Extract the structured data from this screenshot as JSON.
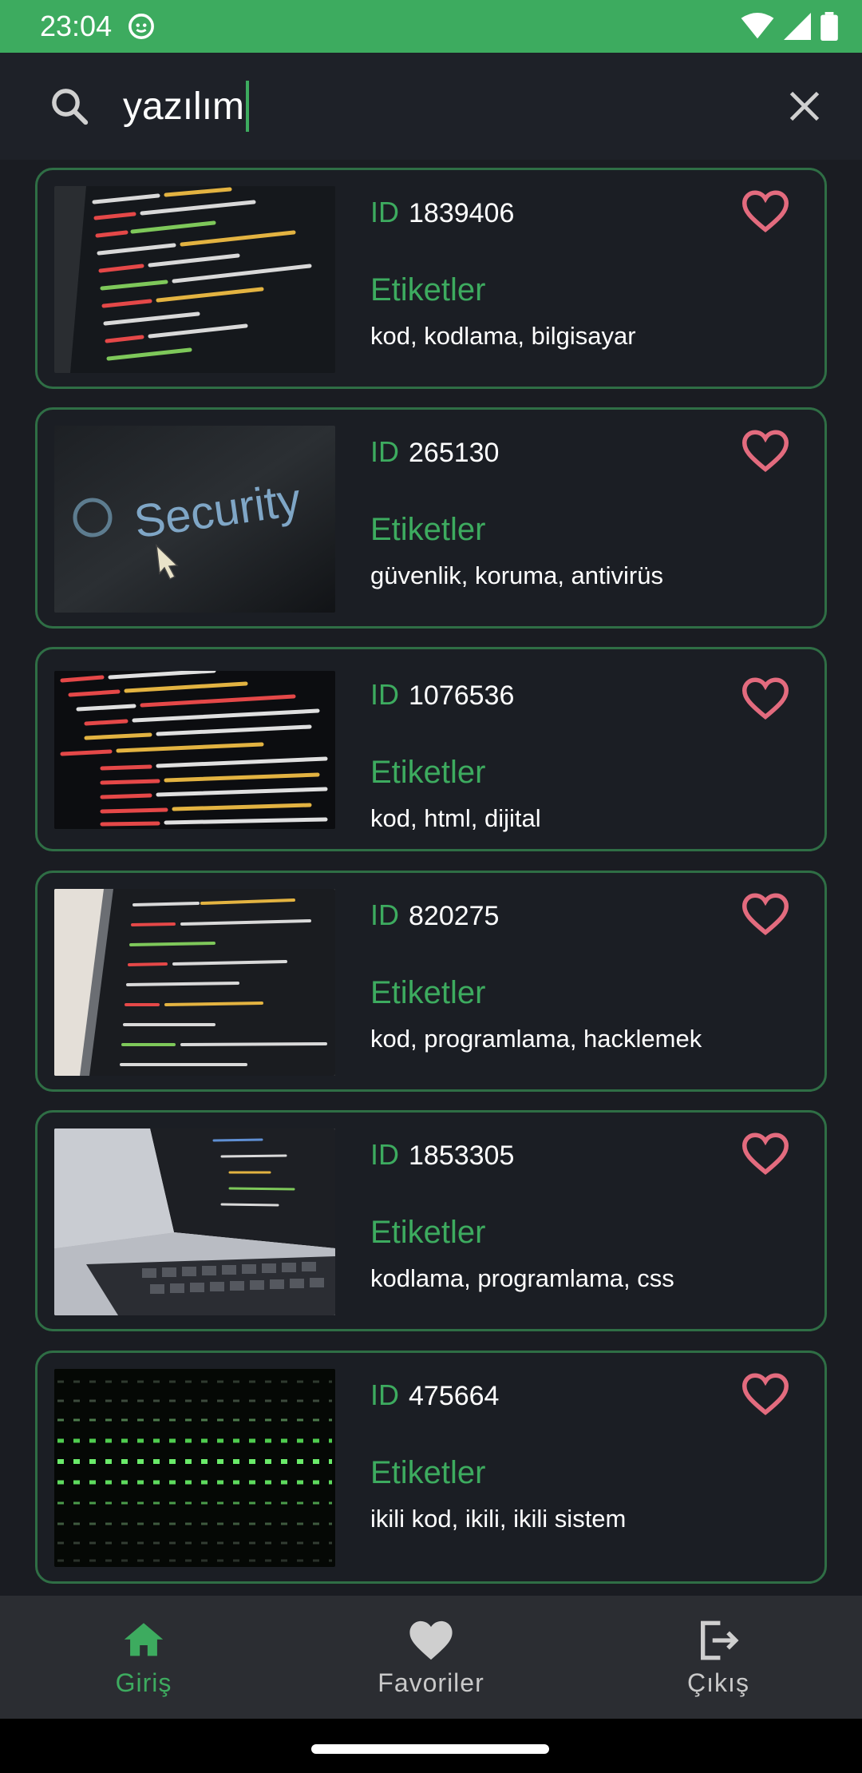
{
  "status_bar": {
    "time": "23:04"
  },
  "search": {
    "query": "yazılım"
  },
  "list": {
    "id_label": "ID",
    "tags_label": "Etiketler",
    "items": [
      {
        "id": "1839406",
        "tags": "kod, kodlama, bilgisayar"
      },
      {
        "id": "265130",
        "tags": "güvenlik, koruma, antivirüs"
      },
      {
        "id": "1076536",
        "tags": "kod, html, dijital"
      },
      {
        "id": "820275",
        "tags": "kod, programlama, hacklemek"
      },
      {
        "id": "1853305",
        "tags": "kodlama, programlama, css"
      },
      {
        "id": "475664",
        "tags": "ikili kod, ikili, ikili sistem"
      }
    ],
    "thumbnail_texts": {
      "security": "Security"
    }
  },
  "bottom_nav": {
    "items": [
      {
        "label": "Giriş",
        "icon": "home-icon",
        "active": true
      },
      {
        "label": "Favoriler",
        "icon": "heart-icon",
        "active": false
      },
      {
        "label": "Çıkış",
        "icon": "logout-icon",
        "active": false
      }
    ]
  },
  "colors": {
    "accent": "#3dab5f",
    "heart": "#e36b7e",
    "card_border": "#2f6e45",
    "background": "#1a1c22"
  }
}
